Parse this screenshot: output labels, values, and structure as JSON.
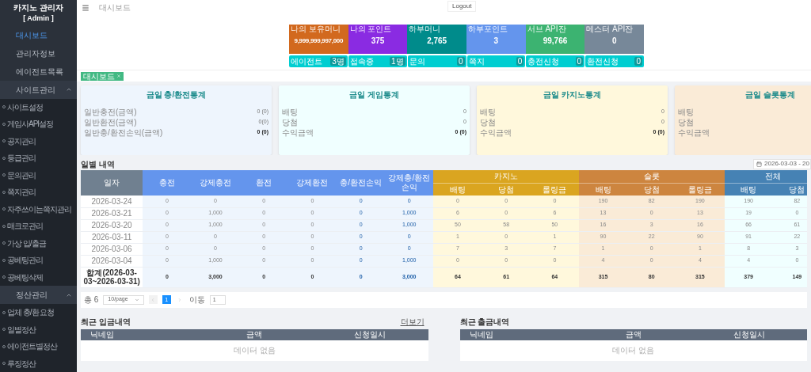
{
  "sidebar": {
    "title": "카지노 관리자",
    "subtitle": "[ Admin ]",
    "items": [
      {
        "label": "대시보드",
        "selected": true
      },
      {
        "label": "관리자정보",
        "selected": false
      },
      {
        "label": "에이전트목록",
        "selected": false
      },
      {
        "label": "사이트관리",
        "selected": false,
        "expanded": true,
        "children": [
          {
            "label": "사이트설정"
          },
          {
            "label": "게임사API설정"
          },
          {
            "label": "공지관리"
          },
          {
            "label": "등급관리"
          },
          {
            "label": "문의관리"
          },
          {
            "label": "쪽지관리"
          },
          {
            "label": "자주쓰이는쪽지관리"
          },
          {
            "label": "매크로관리"
          },
          {
            "label": "가상 입/출금"
          },
          {
            "label": "공베팅관리"
          },
          {
            "label": "공베팅삭제"
          }
        ]
      },
      {
        "label": "정산관리",
        "selected": false,
        "expanded": true,
        "children": [
          {
            "label": "업체 충/환 요청"
          },
          {
            "label": "일별정산"
          },
          {
            "label": "에이전트별정산"
          },
          {
            "label": "루징정산"
          }
        ]
      }
    ]
  },
  "header": {
    "breadcrumb": "대시보드",
    "logout": "Logout"
  },
  "stats": [
    {
      "label": "나의 보유머니",
      "value": "9,999,999,997,000",
      "color": "#d2691e"
    },
    {
      "label": "나의 포인트",
      "value": "375",
      "color": "#8a2be2"
    },
    {
      "label": "하부머니",
      "value": "2,765",
      "color": "#008b8b"
    },
    {
      "label": "하부포인트",
      "value": "3",
      "color": "#6495ed"
    },
    {
      "label": "서브 API잔",
      "value": "99,766",
      "color": "#3cb371"
    },
    {
      "label": "메스터 API잔",
      "value": "0",
      "color": "#778899"
    }
  ],
  "counters": [
    {
      "label": "에이전트",
      "count": "3명"
    },
    {
      "label": "접속중",
      "count": "1명"
    },
    {
      "label": "문의",
      "count": "0"
    },
    {
      "label": "쪽지",
      "count": "0"
    },
    {
      "label": "충전신청",
      "count": "0"
    },
    {
      "label": "환전신청",
      "count": "0"
    }
  ],
  "tabs": [
    {
      "label": "대시보드",
      "selected": true
    }
  ],
  "cards": [
    {
      "title": "금일 충/환전통계",
      "color": "#eef5fd",
      "rows": [
        {
          "label": "일반충전(금액)",
          "value": "0 (0)",
          "strong": false
        },
        {
          "label": "일반환전(금액)",
          "value": "0(0)",
          "strong": false
        },
        {
          "label": "일반충/환전손익(금액)",
          "value": "0 (0)",
          "strong": true
        }
      ]
    },
    {
      "title": "금일 게임통계",
      "color": "#f0ffff",
      "rows": [
        {
          "label": "배팅",
          "value": "0",
          "strong": false
        },
        {
          "label": "당첨",
          "value": "0",
          "strong": false
        },
        {
          "label": "수익금액",
          "value": "0 (0)",
          "strong": true
        }
      ]
    },
    {
      "title": "금일 카지노통계",
      "color": "#fff8dc",
      "rows": [
        {
          "label": "배팅",
          "value": "0",
          "strong": false
        },
        {
          "label": "당첨",
          "value": "0",
          "strong": false
        },
        {
          "label": "수익금액",
          "value": "0 (0)",
          "strong": true
        }
      ]
    },
    {
      "title": "금일 슬롯통계",
      "color": "#faebd7",
      "rows": [
        {
          "label": "배팅"
        },
        {
          "label": "당첨"
        },
        {
          "label": "수익금액"
        }
      ]
    }
  ],
  "daily": {
    "title": "일별 내역",
    "date_range": "2026-03-03 - 20",
    "groups": [
      {
        "kind": "date",
        "columns": [
          {
            "label": "일자",
            "accent": false
          }
        ]
      },
      {
        "kind": "money",
        "columns": [
          {
            "label": "충전",
            "accent": false
          },
          {
            "label": "강제충전",
            "accent": false
          },
          {
            "label": "환전",
            "accent": false
          },
          {
            "label": "강제환전",
            "accent": false
          },
          {
            "label": "충/환전손익",
            "accent": true
          },
          {
            "label": "강제충/환전손익",
            "accent": true
          }
        ]
      },
      {
        "kind": "casino",
        "title": "카지노",
        "columns": [
          {
            "label": "배팅",
            "accent": false
          },
          {
            "label": "당첨",
            "accent": false
          },
          {
            "label": "롤링금",
            "accent": false
          }
        ]
      },
      {
        "kind": "slot",
        "title": "슬롯",
        "columns": [
          {
            "label": "배팅",
            "accent": false
          },
          {
            "label": "당첨",
            "accent": false
          },
          {
            "label": "롤링금",
            "accent": false
          }
        ]
      },
      {
        "kind": "total",
        "title": "전체",
        "columns": [
          {
            "label": "배팅",
            "accent": false
          },
          {
            "label": "당첨",
            "accent": false
          }
        ]
      }
    ],
    "rows": [
      {
        "kind": "day",
        "cells": [
          "2026-03-24",
          "0",
          "0",
          "0",
          "0",
          "0",
          "0",
          "0",
          "0",
          "0",
          "190",
          "82",
          "190",
          "190",
          "82"
        ]
      },
      {
        "kind": "day",
        "cells": [
          "2026-03-21",
          "0",
          "1,000",
          "0",
          "0",
          "0",
          "1,000",
          "6",
          "0",
          "6",
          "13",
          "0",
          "13",
          "19",
          "0"
        ]
      },
      {
        "kind": "day",
        "cells": [
          "2026-03-20",
          "0",
          "1,000",
          "0",
          "0",
          "0",
          "1,000",
          "50",
          "58",
          "50",
          "16",
          "3",
          "16",
          "66",
          "61"
        ]
      },
      {
        "kind": "day",
        "cells": [
          "2026-03-11",
          "0",
          "0",
          "0",
          "0",
          "0",
          "0",
          "1",
          "0",
          "1",
          "90",
          "22",
          "90",
          "91",
          "22"
        ]
      },
      {
        "kind": "day",
        "cells": [
          "2026-03-06",
          "0",
          "0",
          "0",
          "0",
          "0",
          "0",
          "7",
          "3",
          "7",
          "1",
          "0",
          "1",
          "8",
          "3"
        ]
      },
      {
        "kind": "day",
        "cells": [
          "2026-03-04",
          "0",
          "1,000",
          "0",
          "0",
          "0",
          "1,000",
          "0",
          "0",
          "0",
          "4",
          "0",
          "4",
          "4",
          "0"
        ]
      },
      {
        "kind": "total",
        "cells": [
          "합계(2026-03-03~2026-03-31)",
          "0",
          "3,000",
          "0",
          "0",
          "0",
          "3,000",
          "64",
          "61",
          "64",
          "315",
          "80",
          "315",
          "379",
          "149"
        ]
      }
    ],
    "pagination": {
      "total": "총 6",
      "page_size": "10/page",
      "pages": [
        {
          "label": "1",
          "selected": true
        }
      ],
      "goto_label": "이동",
      "goto_value": "1"
    }
  },
  "recent": [
    {
      "title": "최근 입금내역",
      "more": "더보기",
      "columns": [
        "닉네임",
        "금액",
        "신청일시"
      ],
      "empty": "데이터 없음"
    },
    {
      "title": "최근 출금내역",
      "columns": [
        "닉네임",
        "금액",
        "신청일시"
      ],
      "empty": "데이터 없음"
    }
  ]
}
